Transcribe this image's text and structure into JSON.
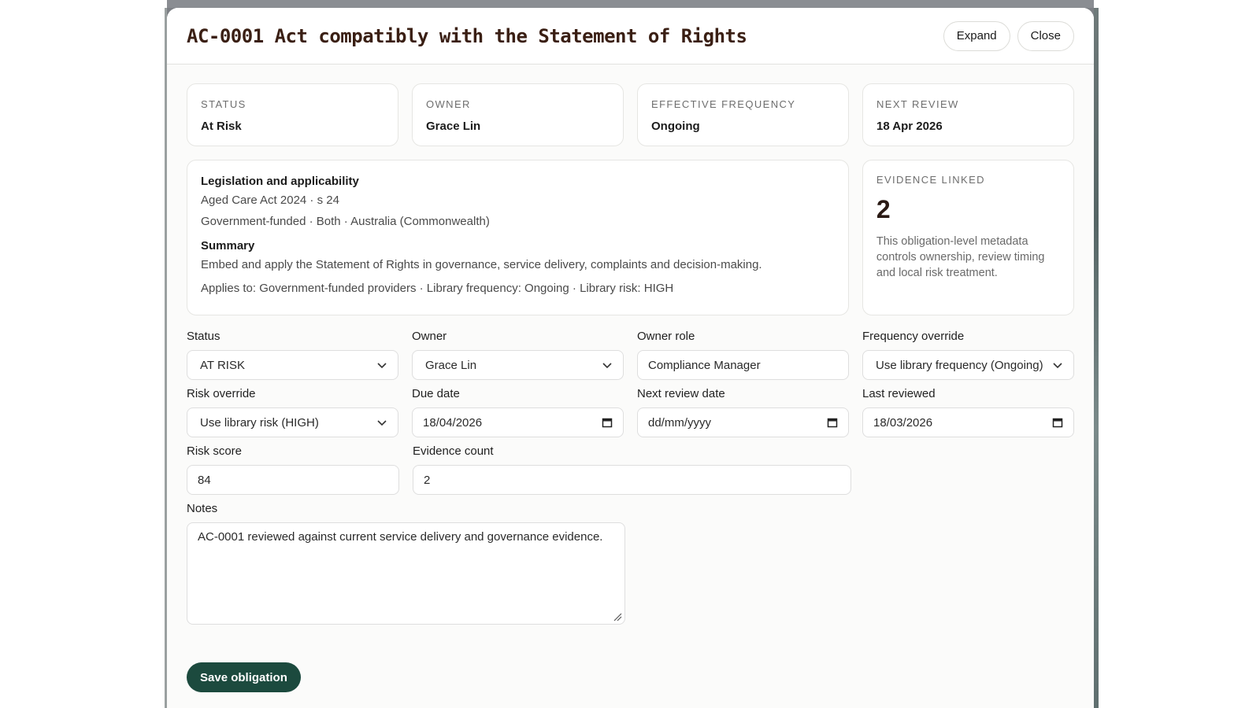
{
  "modal": {
    "title": "AC-0001 Act compatibly with the Statement of Rights",
    "expand_label": "Expand",
    "close_label": "Close"
  },
  "stats": [
    {
      "label": "STATUS",
      "value": "At Risk"
    },
    {
      "label": "OWNER",
      "value": "Grace Lin"
    },
    {
      "label": "EFFECTIVE FREQUENCY",
      "value": "Ongoing"
    },
    {
      "label": "NEXT REVIEW",
      "value": "18 Apr 2026"
    }
  ],
  "legislation": {
    "heading": "Legislation and applicability",
    "act": "Aged Care Act 2024 · s 24",
    "scope": "Government-funded · Both · Australia (Commonwealth)",
    "summary_heading": "Summary",
    "summary": "Embed and apply the Statement of Rights in governance, service delivery, complaints and decision-making.",
    "applies": "Applies to: Government-funded providers · Library frequency: Ongoing · Library risk: HIGH"
  },
  "evidence": {
    "label": "EVIDENCE LINKED",
    "count": "2",
    "note": "This obligation-level metadata controls ownership, review timing and local risk treatment."
  },
  "form": {
    "status": {
      "label": "Status",
      "value": "AT RISK"
    },
    "owner": {
      "label": "Owner",
      "value": "Grace Lin"
    },
    "owner_role": {
      "label": "Owner role",
      "value": "Compliance Manager"
    },
    "frequency_override": {
      "label": "Frequency override",
      "value": "Use library frequency (Ongoing)"
    },
    "risk_override": {
      "label": "Risk override",
      "value": "Use library risk (HIGH)"
    },
    "due_date": {
      "label": "Due date",
      "value": "18/04/2026"
    },
    "next_review_date": {
      "label": "Next review date",
      "value": "dd/mm/yyyy"
    },
    "last_reviewed": {
      "label": "Last reviewed",
      "value": "18/03/2026"
    },
    "risk_score": {
      "label": "Risk score",
      "value": "84"
    },
    "evidence_count": {
      "label": "Evidence count",
      "value": "2"
    },
    "notes": {
      "label": "Notes",
      "value": "AC-0001 reviewed against current service delivery and governance evidence."
    }
  },
  "save_label": "Save obligation",
  "colors": {
    "primary_button": "#1c4a3e",
    "title": "#3a1f14"
  }
}
